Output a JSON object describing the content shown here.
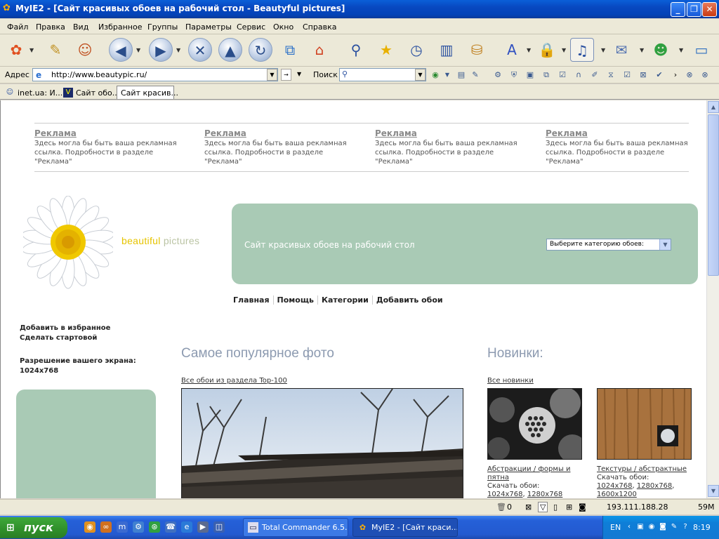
{
  "window": {
    "title": "MyIE2 - [Сайт красивых обоев на рабочий стол - Beautyful pictures]"
  },
  "menu": [
    "Файл",
    "Правка",
    "Вид",
    "Избранное",
    "Группы",
    "Параметры",
    "Сервис",
    "Окно",
    "Справка"
  ],
  "addressbar": {
    "label": "Адрес",
    "url": "http://www.beautypic.ru/",
    "search_label": "Поиск"
  },
  "tabs": [
    {
      "label": "inet.ua: И..."
    },
    {
      "label": "Сайт обо..."
    },
    {
      "label": "Сайт красив..."
    }
  ],
  "page": {
    "ads": [
      {
        "title": "Реклама",
        "text": "Здесь могла бы быть ваша рекламная ссылка. Подробности в разделе \"Реклама\""
      },
      {
        "title": "Реклама",
        "text": "Здесь могла бы быть ваша рекламная ссылка. Подробности в разделе \"Реклама\""
      },
      {
        "title": "Реклама",
        "text": "Здесь могла бы быть ваша рекламная ссылка. Подробности в разделе \"Реклама\""
      },
      {
        "title": "Реклама",
        "text": "Здесь могла бы быть ваша рекламная ссылка. Подробности в разделе \"Реклама\""
      }
    ],
    "brand": {
      "part1": "beautiful",
      "part2": "pictures"
    },
    "slogan": "Сайт красивых обоев на рабочий стол",
    "category_select": "Выберите категорию обоев:",
    "nav": [
      "Главная",
      "Помощь",
      "Категории",
      "Добавить обои"
    ],
    "sidebar": {
      "favorites": "Добавить в избранное",
      "homepage": "Сделать стартовой",
      "resolution_label": "Разрешение вашего экрана:",
      "resolution_value": "1024x768"
    },
    "popular": {
      "heading": "Самое популярное фото",
      "link": "Все обои из раздела Top-100"
    },
    "new": {
      "heading": "Новинки:",
      "link": "Все новинки",
      "items": [
        {
          "category": "Абстракции / формы и пятна",
          "download": "Скачать обои:",
          "sizes": [
            "1024x768",
            "1280x768"
          ]
        },
        {
          "category": "Текстуры / абстрактные",
          "download": "Скачать обои:",
          "sizes": [
            "1024x768",
            "1280x768",
            "1600x1200"
          ]
        }
      ]
    }
  },
  "statusbar": {
    "count": "0",
    "ip": "193.111.188.28",
    "memory": "59M"
  },
  "taskbar": {
    "start": "пуск",
    "tasks": [
      {
        "label": "Total Commander 6.5..."
      },
      {
        "label": "MyIE2 - [Сайт краси..."
      }
    ],
    "lang": "EN",
    "clock": "8:19"
  }
}
